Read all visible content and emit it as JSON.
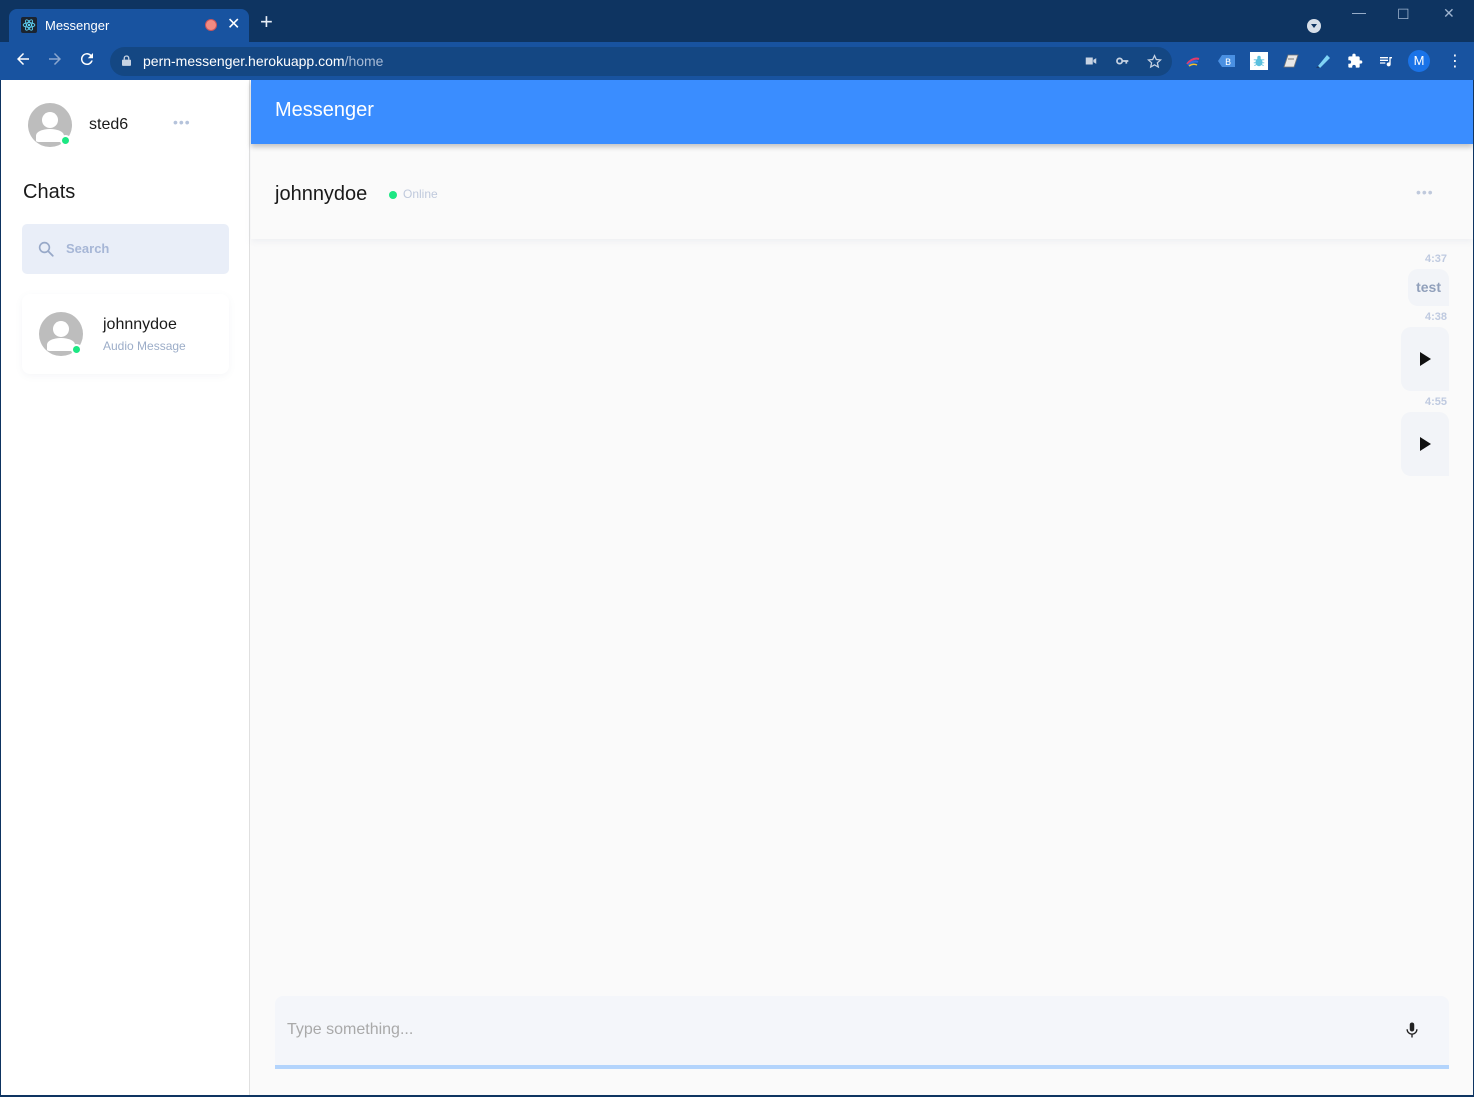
{
  "browser": {
    "tab": {
      "title": "Messenger",
      "favicon": "react-icon",
      "recording_indicator": true
    },
    "new_tab_icon": "plus-icon",
    "window_controls": [
      "minimize-icon",
      "maximize-icon",
      "close-icon"
    ],
    "address": {
      "host": "pern-messenger.herokuapp.com",
      "path": "/home"
    },
    "omnibox_icons": [
      "camera-icon",
      "key-icon",
      "star-icon"
    ],
    "extensions": [
      "color-picker-extension",
      "tag-extension",
      "bug-extension",
      "eraser-extension",
      "highlighter-extension",
      "puzzle-icon",
      "playlist-icon"
    ],
    "profile_initial": "M"
  },
  "sidebar": {
    "user": {
      "name": "sted6",
      "online": true
    },
    "chats_title": "Chats",
    "search": {
      "placeholder": "Search"
    },
    "conversations": [
      {
        "name": "johnnydoe",
        "preview": "Audio Message",
        "online": true
      }
    ]
  },
  "main": {
    "app_title": "Messenger",
    "chat_header": {
      "name": "johnnydoe",
      "status": "Online"
    },
    "messages": [
      {
        "time": "4:37",
        "type": "text",
        "text": "test"
      },
      {
        "time": "4:38",
        "type": "audio"
      },
      {
        "time": "4:55",
        "type": "audio"
      }
    ],
    "composer": {
      "placeholder": "Type something...",
      "value": ""
    }
  },
  "colors": {
    "accent": "#3a8dff",
    "online": "#1ce783",
    "browser_frame": "#0e3461",
    "browser_toolbar": "#1853a0"
  }
}
